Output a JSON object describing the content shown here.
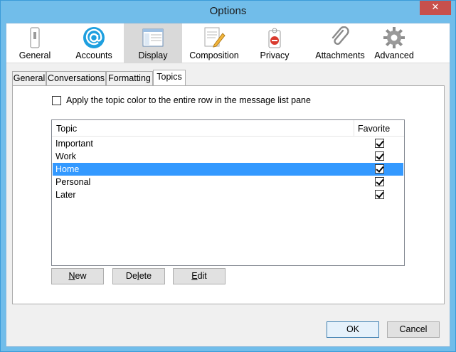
{
  "window": {
    "title": "Options",
    "close_glyph": "✕"
  },
  "categories": [
    {
      "id": "general",
      "label": "General",
      "icon": "switch-icon"
    },
    {
      "id": "accounts",
      "label": "Accounts",
      "icon": "at-sign-icon"
    },
    {
      "id": "display",
      "label": "Display",
      "icon": "window-layout-icon",
      "selected": true
    },
    {
      "id": "composition",
      "label": "Composition",
      "icon": "pen-notepad-icon"
    },
    {
      "id": "privacy",
      "label": "Privacy",
      "icon": "do-not-disturb-tag-icon"
    },
    {
      "id": "attachments",
      "label": "Attachments",
      "icon": "paperclip-icon"
    },
    {
      "id": "advanced",
      "label": "Advanced",
      "icon": "gear-icon"
    }
  ],
  "subtabs": [
    {
      "label": "General"
    },
    {
      "label": "Conversations"
    },
    {
      "label": "Formatting"
    },
    {
      "label": "Topics",
      "active": true
    }
  ],
  "topics_panel": {
    "apply_color_label": "Apply the topic color to the entire row in the message list pane",
    "apply_color_checked": false,
    "columns": {
      "topic": "Topic",
      "favorite": "Favorite"
    },
    "rows": [
      {
        "name": "Important",
        "favorite": true,
        "selected": false
      },
      {
        "name": "Work",
        "favorite": true,
        "selected": false
      },
      {
        "name": "Home",
        "favorite": true,
        "selected": true
      },
      {
        "name": "Personal",
        "favorite": true,
        "selected": false
      },
      {
        "name": "Later",
        "favorite": true,
        "selected": false
      }
    ],
    "buttons": {
      "new_accel": "N",
      "new_rest": "ew",
      "delete_pre": "De",
      "delete_accel": "l",
      "delete_rest": "ete",
      "edit_accel": "E",
      "edit_rest": "dit"
    }
  },
  "dialog_buttons": {
    "ok": "OK",
    "cancel": "Cancel"
  },
  "colors": {
    "selection": "#3399ff",
    "title_bar": "#71bdea",
    "close_button": "#c7504c"
  }
}
